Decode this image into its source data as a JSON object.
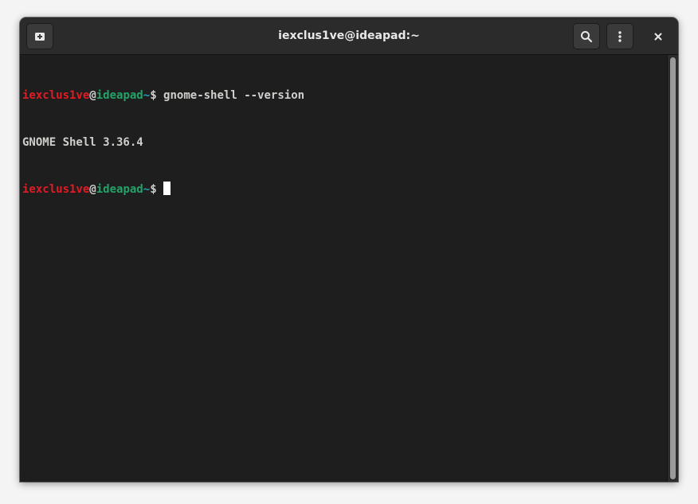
{
  "window": {
    "title": "iexclus1ve@ideapad:~"
  },
  "headerbar": {
    "new_tab_icon": "new-tab-icon",
    "search_icon": "search-icon",
    "menu_icon": "kebab-menu-icon",
    "close_icon": "close-icon"
  },
  "terminal": {
    "lines": [
      {
        "user": "iexclus1ve",
        "at": "@",
        "host": "ideapad",
        "path": "~",
        "dollar": "$",
        "command": " gnome-shell --version"
      },
      {
        "output": "GNOME Shell 3.36.4"
      },
      {
        "user": "iexclus1ve",
        "at": "@",
        "host": "ideapad",
        "path": "~",
        "dollar": "$",
        "command": " "
      }
    ]
  },
  "colors": {
    "user": "#e01b24",
    "host": "#26a269",
    "path": "#2aa1b3",
    "text": "#d0cfcc",
    "background": "#1e1e1e",
    "headerbar": "#2b2b2b"
  }
}
